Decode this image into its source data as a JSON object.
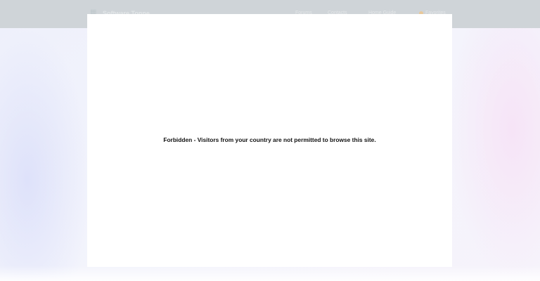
{
  "header": {
    "logo_icon": "logo-mark-icon",
    "site_name": "Software Tonne",
    "nav": [
      {
        "label": "Forums"
      },
      {
        "label": "Contacts"
      },
      {
        "label": "Home Guide"
      },
      {
        "label": "Favorites",
        "icon": "dot-icon",
        "accent": "#e8c89a"
      }
    ]
  },
  "overlay": {
    "message": "Forbidden - Visitors from your country are not permitted to browse this site."
  },
  "colors": {
    "header_bg": "#cfd4d8",
    "page_bg": "#eef0fb",
    "card_bg": "#ffffff",
    "text": "#111111"
  }
}
